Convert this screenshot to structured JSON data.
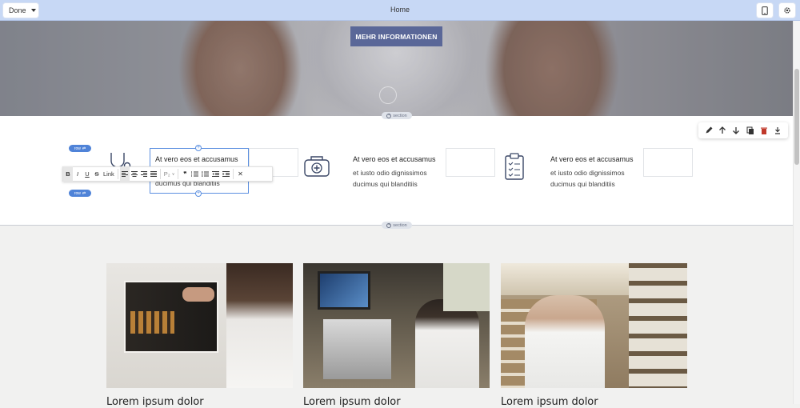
{
  "topbar": {
    "done_label": "Done",
    "page_name": "Home",
    "icons": [
      "mobile-icon",
      "gear-icon"
    ]
  },
  "hero": {
    "button_label": "MEHR INFORMATIONEN"
  },
  "section_label": "section",
  "row_label": "row",
  "features": [
    {
      "icon": "stethoscope-icon",
      "title": "At vero eos et accusamus",
      "text_line1": "et iusto odio dignissimos",
      "text_line2": "ducimus qui blanditiis"
    },
    {
      "icon": "medical-kit-icon",
      "title": "At vero eos et accusamus",
      "text_line1": "et iusto odio dignissimos",
      "text_line2": "ducimus qui blanditiis"
    },
    {
      "icon": "clipboard-checklist-icon",
      "title": "At vero eos et accusamus",
      "text_line1": "et iusto odio dignissimos",
      "text_line2": "ducimus qui blanditiis"
    }
  ],
  "rte_toolbar": {
    "bold": "B",
    "italic": "I",
    "underline": "U",
    "strike": "S",
    "link": "Link",
    "paragraph": "P₂",
    "quote": "❞",
    "close": "✕"
  },
  "section_tools": [
    "edit-icon",
    "arrow-up-icon",
    "arrow-down-icon",
    "copy-icon",
    "delete-icon",
    "download-icon"
  ],
  "cards": [
    {
      "title": "Lorem ipsum dolor",
      "image": "doctor-xray-image"
    },
    {
      "title": "Lorem ipsum dolor",
      "image": "lab-microscope-image"
    },
    {
      "title": "Lorem ipsum dolor",
      "image": "pharmacist-shelves-image"
    }
  ],
  "colors": {
    "topbar": "#c7d8f5",
    "hero_button": "#5a6798",
    "selection": "#5b8fe0"
  }
}
